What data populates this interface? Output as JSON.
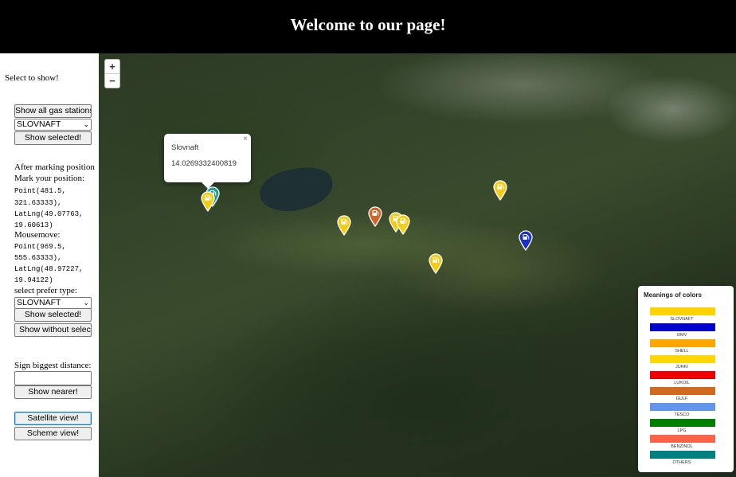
{
  "header": {
    "title": "Welcome to our page!"
  },
  "sidebar": {
    "select_to_show": "Select to show!",
    "show_all_button": "Show all gas stations!",
    "brand_select_value": "SLOVNAFT",
    "show_selected_button": "Show selected!",
    "after_marking": "After marking position",
    "mark_position": "Mark your position:",
    "point1": "Point(481.5,",
    "point1b": "321.63333),",
    "latlng1": "LatLng(49.07763,",
    "latlng1b": "19.60613)",
    "mousemove": "Mousemove:",
    "point2": "Point(969.5,",
    "point2b": "555.63333),",
    "latlng2": "LatLng(48.97227,",
    "latlng2b": "19.94122)",
    "prefer_type": "select prefer type:",
    "type_select_value": "SLOVNAFT",
    "show_selected_button2": "Show selected!",
    "show_without_button": "Show without selection!",
    "sign_distance": "Sign biggest distance:",
    "distance_value": "",
    "show_nearer_button": "Show nearer!",
    "satellite_button": "Satellite view!",
    "scheme_button": "Scheme view!"
  },
  "map": {
    "zoom_in": "+",
    "zoom_out": "−",
    "popup": {
      "name": "Slovnaft",
      "value": "14.0269332400819",
      "close": "×"
    },
    "markers": [
      {
        "color": "#1f9e93"
      },
      {
        "color": "#f2cc16"
      },
      {
        "color": "#f2cc16"
      },
      {
        "color": "#d2632a"
      },
      {
        "color": "#f2cc16"
      },
      {
        "color": "#f2cc16"
      },
      {
        "color": "#f2cc16"
      },
      {
        "color": "#1a2fc9"
      }
    ]
  },
  "legend": {
    "title": "Meanings of colors",
    "items": [
      {
        "label": "SLOVNAFT",
        "color": "#ffd200"
      },
      {
        "label": "OMV",
        "color": "#0000cc"
      },
      {
        "label": "SHELL",
        "color": "#ffa500"
      },
      {
        "label": "JURKI",
        "color": "#ffd700"
      },
      {
        "label": "LUKOIL",
        "color": "#ee0000"
      },
      {
        "label": "GULF",
        "color": "#d2691e"
      },
      {
        "label": "TESCO",
        "color": "#6495ed"
      },
      {
        "label": "LPG",
        "color": "#008000"
      },
      {
        "label": "BENZINOL",
        "color": "#ff6347"
      },
      {
        "label": "OTHERS",
        "color": "#008080"
      }
    ]
  }
}
